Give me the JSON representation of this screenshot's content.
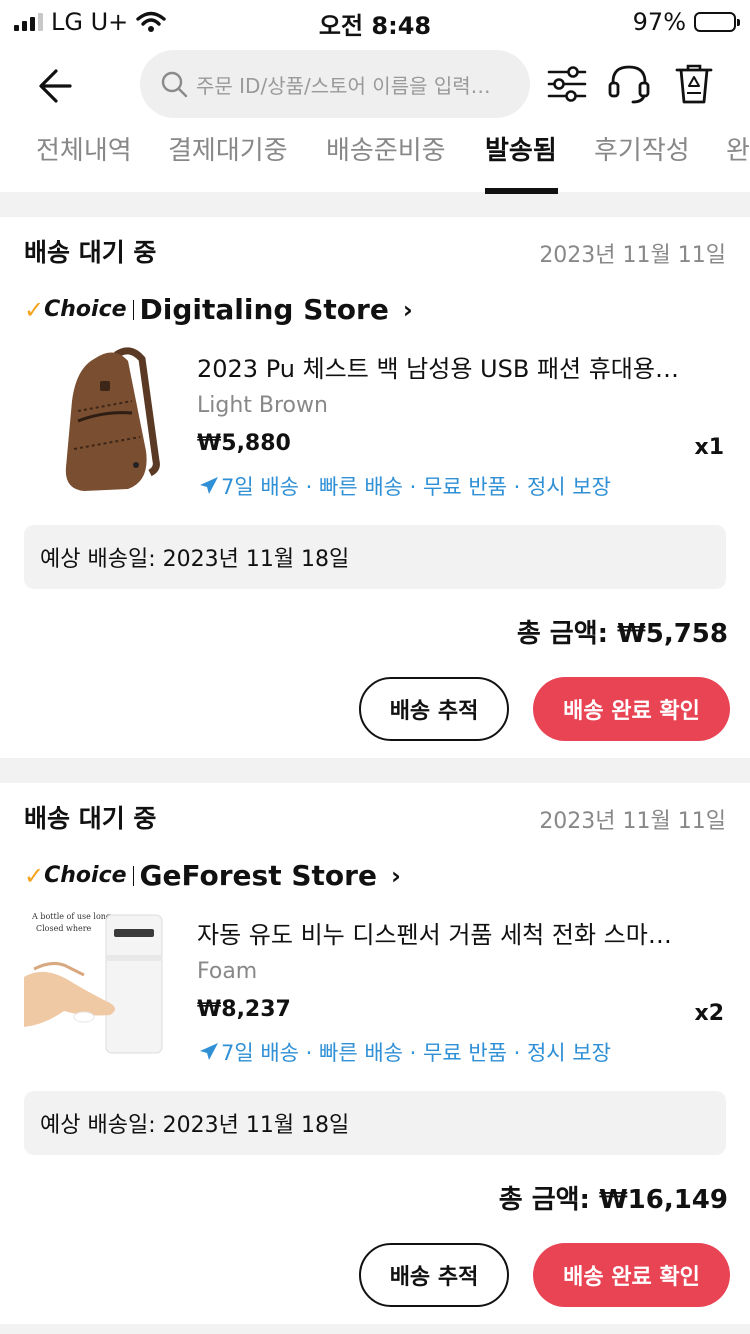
{
  "status_bar": {
    "carrier": "LG U+",
    "time": "오전 8:48",
    "battery": "97%",
    "battery_level": 0.97
  },
  "header": {
    "back_icon": "back-arrow-icon",
    "search_placeholder": "주문 ID/상품/스토어 이름을 입력…",
    "icons": [
      "filter-icon",
      "headset-icon",
      "recycle-trash-icon"
    ]
  },
  "tabs": [
    {
      "label": "전체내역",
      "active": false
    },
    {
      "label": "결제대기중",
      "active": false
    },
    {
      "label": "배송준비중",
      "active": false
    },
    {
      "label": "발송됨",
      "active": true
    },
    {
      "label": "후기작성",
      "active": false
    },
    {
      "label": "완",
      "active": false
    }
  ],
  "orders": [
    {
      "status": "배송 대기 중",
      "date": "2023년 11월 11일",
      "choice_label": "Choice",
      "store": "Digitaling Store",
      "product_title": "2023 Pu 체스트 백 남성용 USB 패션 휴대용…",
      "variant": "Light Brown",
      "price": "₩5,880",
      "qty": "x1",
      "delivery": "7일 배송 · 빠른 배송 · 무료 반품 · 정시 보장",
      "eta": "예상 배송일: 2023년 11월 18일",
      "total": "총 금액: ₩5,758",
      "track_label": "배송 추적",
      "confirm_label": "배송 완료 확인"
    },
    {
      "status": "배송 대기 중",
      "date": "2023년 11월 11일",
      "choice_label": "Choice",
      "store": "GeForest Store",
      "product_title": "자동 유도 비누 디스펜서 거품 세척 전화 스마…",
      "variant": "Foam",
      "price": "₩8,237",
      "qty": "x2",
      "delivery": "7일 배송 · 빠른 배송 · 무료 반품 · 정시 보장",
      "eta": "예상 배송일: 2023년 11월 18일",
      "total": "총 금액: ₩16,149",
      "track_label": "배송 추적",
      "confirm_label": "배송 완료 확인",
      "thumb_text": [
        "A bottle of use longer",
        "Closed where"
      ]
    }
  ],
  "colors": {
    "accent": "#e94454",
    "delivery_blue": "#2f90d6",
    "choice_orange": "#f4a31c"
  }
}
